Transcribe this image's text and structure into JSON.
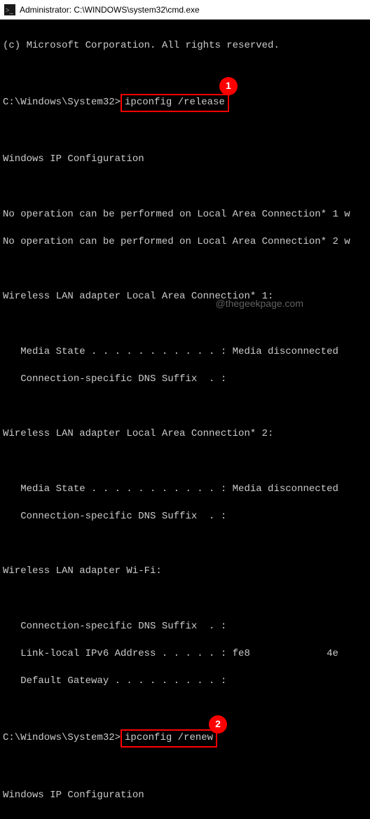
{
  "titlebar": {
    "icon_name": "cmd-icon",
    "text": "Administrator: C:\\WINDOWS\\system32\\cmd.exe"
  },
  "terminal": {
    "copyright": "(c) Microsoft Corporation. All rights reserved.",
    "prompt1_path": "C:\\Windows\\System32>",
    "command1": "ipconfig /release",
    "ipconfig_header": "Windows IP Configuration",
    "noop1": "No operation can be performed on Local Area Connection* 1 w",
    "noop2": "No operation can be performed on Local Area Connection* 2 w",
    "wlan1_header": "Wireless LAN adapter Local Area Connection* 1:",
    "wlan1_media": "   Media State . . . . . . . . . . . : Media disconnected",
    "wlan1_dns": "   Connection-specific DNS Suffix  . :",
    "wlan2_header": "Wireless LAN adapter Local Area Connection* 2:",
    "wlan2_media": "   Media State . . . . . . . . . . . : Media disconnected",
    "wlan2_dns": "   Connection-specific DNS Suffix  . :",
    "wifi_header": "Wireless LAN adapter Wi-Fi:",
    "wifi_dns": "   Connection-specific DNS Suffix  . :",
    "wifi_ipv6": "   Link-local IPv6 Address . . . . . : fe8             4e",
    "wifi_gateway": "   Default Gateway . . . . . . . . . :",
    "prompt2_path": "C:\\Windows\\System32>",
    "command2": "ipconfig /renew",
    "ipconfig_header2": "Windows IP Configuration"
  },
  "annotations": {
    "badge1": "1",
    "badge2": "2"
  },
  "watermark": "@thegeekpage.com"
}
